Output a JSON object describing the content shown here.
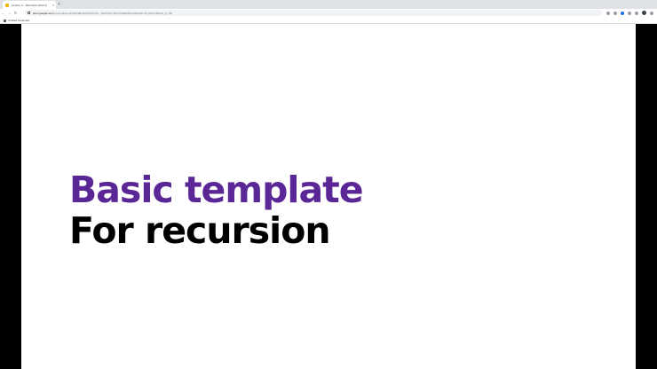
{
  "browser": {
    "tab_title": "Lecture 4 – Recursion (Part 1)",
    "tab_close": "×",
    "new_tab": "+",
    "back": "←",
    "forward": "→",
    "reload": "↻",
    "url_host": "docs.google.com",
    "url_path": "/presentation/d/1h4lb8Ez3k5cD8vwL2x_1dPZWt0Y6P0vK9aBeMs/edit#slide=id.g1f6f7c8d9e0_0_150",
    "bookmark_label": "Untitled bookmark"
  },
  "slide": {
    "title": "Basic template",
    "subtitle": "For recursion"
  },
  "colors": {
    "title_purple": "#5b2696",
    "subtitle_black": "#000000",
    "letterbox": "#000000"
  }
}
